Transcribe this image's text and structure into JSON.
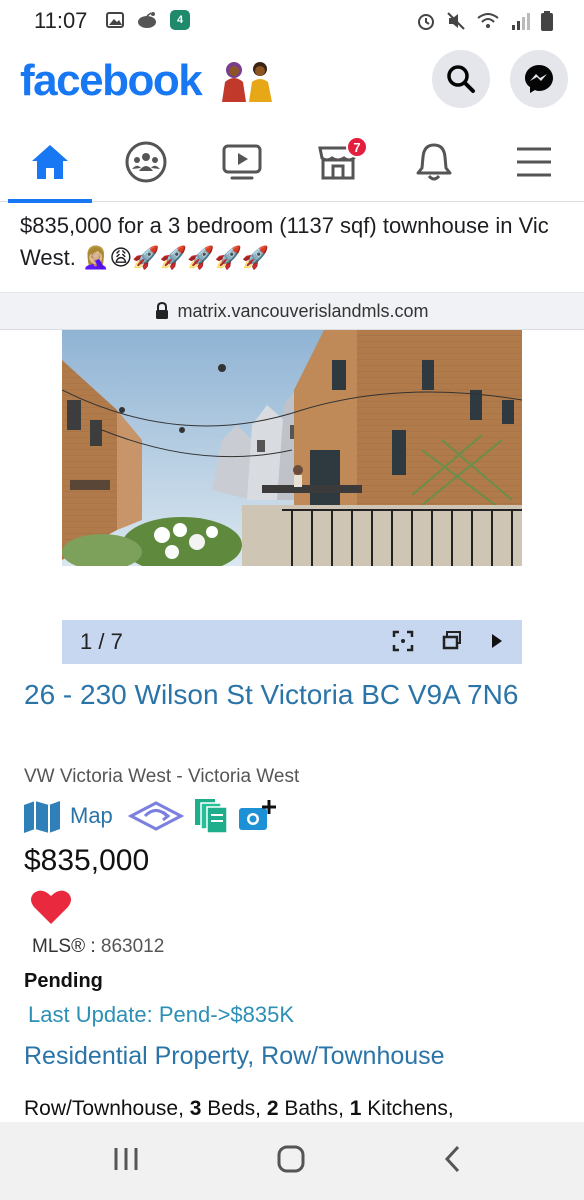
{
  "status_bar": {
    "time": "11:07",
    "notification_badge": "4",
    "icons_left": [
      "gallery-icon",
      "reddit-icon",
      "app-badge-icon"
    ],
    "icons_right": [
      "alarm-icon",
      "mute-icon",
      "wifi-icon",
      "signal-icon",
      "battery-icon"
    ]
  },
  "header": {
    "logo": "facebook",
    "buttons": [
      "search-icon",
      "messenger-icon"
    ]
  },
  "nav": {
    "tabs": [
      {
        "name": "home",
        "icon": "home-icon",
        "active": true
      },
      {
        "name": "groups",
        "icon": "groups-icon",
        "active": false
      },
      {
        "name": "watch",
        "icon": "video-icon",
        "active": false
      },
      {
        "name": "marketplace",
        "icon": "marketplace-icon",
        "active": false,
        "badge": "7"
      },
      {
        "name": "notifications",
        "icon": "bell-icon",
        "active": false
      },
      {
        "name": "menu",
        "icon": "hamburger-menu-icon",
        "active": false
      }
    ],
    "accent": "#1877f2",
    "badge_color": "#e41e3f"
  },
  "post": {
    "text": "$835,000 for a 3 bedroom (1137 sqf) townhouse in Vic West. 🤦🏼‍♀️😩🚀🚀🚀🚀🚀"
  },
  "url_bar": {
    "url": "matrix.vancouverislandmls.com",
    "icon": "lock-icon"
  },
  "carousel": {
    "counter": "1 / 7",
    "controls": [
      "fullscreen-icon",
      "window-icon",
      "play-icon"
    ]
  },
  "listing": {
    "address": "26 - 230 Wilson St Victoria BC V9A 7N6",
    "area": "VW Victoria West - Victoria West",
    "map_label": "Map",
    "price": "$835,000",
    "mls_label": "MLS® :",
    "mls_number": "863012",
    "status": "Pending",
    "last_update": "Last Update: Pend->$835K",
    "property_type": "Residential Property, Row/Townhouse",
    "summary": {
      "type": "Row/Townhouse,",
      "beds": "3",
      "beds_label": "Beds,",
      "baths": "2",
      "baths_label": "Baths,",
      "kitchens": "1",
      "kitchens_label": "Kitchens,"
    },
    "link_color": "#2b74a8",
    "heart_color": "#e8293e"
  },
  "android_nav": [
    "recents-icon",
    "home-button-icon",
    "back-icon"
  ]
}
